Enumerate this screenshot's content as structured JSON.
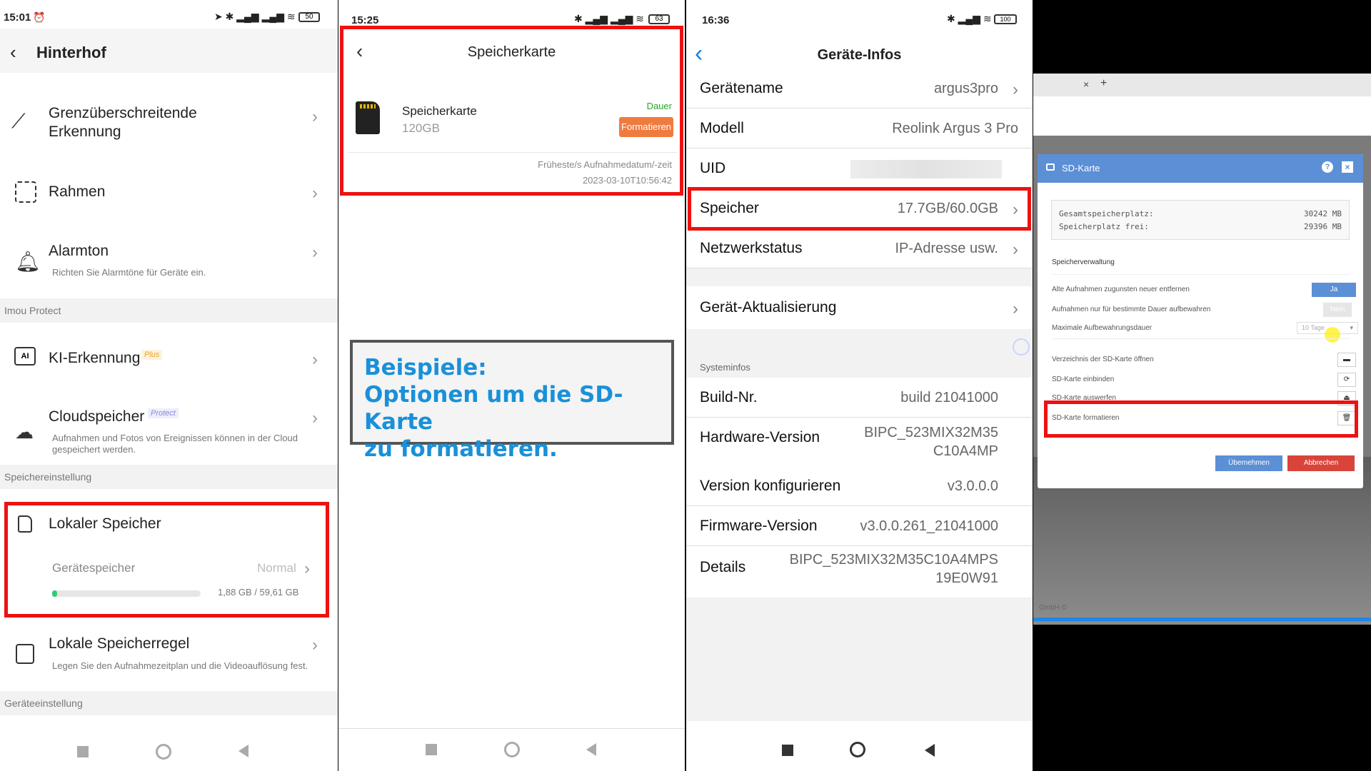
{
  "panel1": {
    "status_time": "15:01",
    "status_battery": "50",
    "title": "Hinterhof",
    "rows": [
      {
        "title": "Grenzüberschreitende Erkennung"
      },
      {
        "title": "Rahmen"
      },
      {
        "title": "Alarmton",
        "sub": "Richten Sie Alarmtöne für Geräte ein."
      }
    ],
    "section_imou": "Imou Protect",
    "ki": {
      "title": "KI-Erkennung",
      "badge": "Plus"
    },
    "cloud": {
      "title": "Cloudspeicher",
      "badge": "Protect",
      "sub": "Aufnahmen und Fotos von Ereignissen können in der Cloud gespeichert werden."
    },
    "section_storage": "Speichereinstellung",
    "local": {
      "title": "Lokaler Speicher",
      "device_label": "Gerätespeicher",
      "status": "Normal",
      "usage": "1,88 GB / 59,61 GB",
      "usage_fraction": 0.03
    },
    "rule": {
      "title": "Lokale Speicherregel",
      "sub": "Legen Sie den Aufnahmezeitplan und die Videoauflösung fest."
    },
    "section_device": "Geräteeinstellung"
  },
  "panel2": {
    "status_time": "15:25",
    "status_battery": "63",
    "title": "Speicherkarte",
    "card_name": "Speicherkarte",
    "card_size": "120GB",
    "mode": "Dauer",
    "format_button": "Formatieren",
    "earliest_label": "Früheste/s Aufnahmedatum/-zeit",
    "earliest_value": "2023-03-10T10:56:42",
    "callout_line1": "Beispiele:",
    "callout_line2": "Optionen um die SD-Karte",
    "callout_line3": "zu formatieren.",
    "colors": {
      "accent": "#1a90d9",
      "format": "#f07b3f",
      "mode": "#2aa52a"
    }
  },
  "panel3": {
    "status_time": "16:36",
    "status_battery": "100",
    "title": "Geräte-Infos",
    "rows": [
      {
        "label": "Gerätename",
        "value": "argus3pro"
      },
      {
        "label": "Modell",
        "value": "Reolink Argus 3 Pro"
      },
      {
        "label": "UID",
        "value": ""
      },
      {
        "label": "Speicher",
        "value": "17.7GB/60.0GB"
      },
      {
        "label": "Netzwerkstatus",
        "value": "IP-Adresse usw."
      }
    ],
    "update_label": "Gerät-Aktualisierung",
    "section_sys": "Systeminfos",
    "sys_rows": [
      {
        "label": "Build-Nr.",
        "value": "build 21041000"
      },
      {
        "label": "Hardware-Version",
        "value1": "BIPC_523MIX32M35",
        "value2": "C10A4MP"
      },
      {
        "label": "Version konfigurieren",
        "value": "v3.0.0.0"
      },
      {
        "label": "Firmware-Version",
        "value": "v3.0.0.261_21041000"
      },
      {
        "label": "Details",
        "value1": "BIPC_523MIX32M35C10A4MPS",
        "value2": "19E0W91"
      }
    ]
  },
  "panel4": {
    "tab_close": "×",
    "tab_add": "+",
    "dialog_title": "SD-Karte",
    "total_label": "Gesamtspeicherplatz:",
    "total_value": "30242 MB",
    "free_label": "Speicherplatz frei:",
    "free_value": "29396 MB",
    "section": "Speicherverwaltung",
    "opt1": "Alte Aufnahmen zugunsten neuer entfernen",
    "opt1_value": "Ja",
    "opt2": "Aufnahmen nur für bestimmte Dauer aufbewahren",
    "opt2_value": "Nein",
    "opt3": "Maximale Aufbewahrungsdauer",
    "opt3_value": "10 Tage",
    "act1": "Verzeichnis der SD-Karte öffnen",
    "act2": "SD-Karte einbinden",
    "act3": "SD-Karte auswerfen",
    "act4": "SD-Karte formatieren",
    "apply": "Übernehmen",
    "cancel": "Abbrechen",
    "footer": "GmbH ©"
  }
}
